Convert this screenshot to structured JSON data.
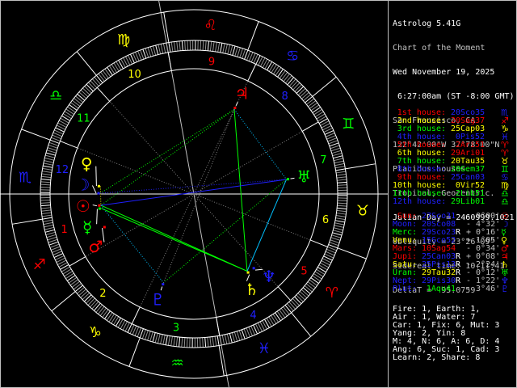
{
  "colors": {
    "fire": "#ff0000",
    "earth": "#ffff00",
    "air": "#00ff00",
    "water": "#2020ff",
    "white": "#ffffff",
    "gray": "#c0c0c0"
  },
  "info": [
    {
      "text": "Astrolog 5.41G",
      "tone": "w"
    },
    {
      "text": "Chart of the Moment",
      "tone": "g"
    },
    {
      "text": "Wed November 19, 2025",
      "tone": "w"
    },
    {
      "text": " 6:27:00am (ST -8:00 GMT)",
      "tone": "w"
    },
    {
      "text": "San Francisco, CA",
      "tone": "g"
    },
    {
      "text": "122°42'00\"W 37°78'00\"N",
      "tone": "g"
    },
    {
      "text": "Placidus houses.",
      "tone": "g"
    },
    {
      "text": "Tropical, Geocentric.",
      "tone": "g"
    },
    {
      "text": "Julian Day = 2460999.1021",
      "tone": "w"
    },
    {
      "text": "Obliquity = 23°26'09\"",
      "tone": "g"
    },
    {
      "text": "Sidereal time: 10:11:41",
      "tone": "g"
    },
    {
      "text": "DeltaT =  95.0759",
      "tone": "g"
    }
  ],
  "ascendant": 230.58,
  "signs": [
    {
      "name": "Ari",
      "glyph": "♈︎",
      "el": "fire",
      "icon": "aries-icon"
    },
    {
      "name": "Tau",
      "glyph": "♉︎",
      "el": "earth",
      "icon": "taurus-icon"
    },
    {
      "name": "Gem",
      "glyph": "♊︎",
      "el": "air",
      "icon": "gemini-icon"
    },
    {
      "name": "Can",
      "glyph": "♋︎",
      "el": "water",
      "icon": "cancer-icon"
    },
    {
      "name": "Leo",
      "glyph": "♌︎",
      "el": "fire",
      "icon": "leo-icon"
    },
    {
      "name": "Vir",
      "glyph": "♍︎",
      "el": "earth",
      "icon": "virgo-icon"
    },
    {
      "name": "Lib",
      "glyph": "♎︎",
      "el": "air",
      "icon": "libra-icon"
    },
    {
      "name": "Sco",
      "glyph": "♏︎",
      "el": "water",
      "icon": "scorpio-icon"
    },
    {
      "name": "Sag",
      "glyph": "♐︎",
      "el": "fire",
      "icon": "sagittarius-icon"
    },
    {
      "name": "Cap",
      "glyph": "♑︎",
      "el": "earth",
      "icon": "capricorn-icon"
    },
    {
      "name": "Aqu",
      "glyph": "♒︎",
      "el": "air",
      "icon": "aquarius-icon"
    },
    {
      "name": "Pis",
      "glyph": "♓︎",
      "el": "water",
      "icon": "pisces-icon"
    }
  ],
  "houses": [
    {
      "label": "1st house:",
      "num": "1",
      "value": "20Sco35",
      "lon": 230.58,
      "sign": 7
    },
    {
      "label": "2nd house:",
      "num": "2",
      "value": "20Sag37",
      "lon": 260.62,
      "sign": 8
    },
    {
      "label": "3rd house:",
      "num": "3",
      "value": "25Cap03",
      "lon": 295.05,
      "sign": 9
    },
    {
      "label": "4th house:",
      "num": "4",
      "value": "0Pis52",
      "lon": 330.87,
      "sign": 11
    },
    {
      "label": "5th house:",
      "num": "5",
      "value": "2Ari51",
      "lon": 2.85,
      "sign": 0
    },
    {
      "label": "6th house:",
      "num": "6",
      "value": "29Ari01",
      "lon": 29.02,
      "sign": 0
    },
    {
      "label": "7th house:",
      "num": "7",
      "value": "20Tau35",
      "lon": 50.58,
      "sign": 1
    },
    {
      "label": "8th house:",
      "num": "8",
      "value": "20Gem37",
      "lon": 80.62,
      "sign": 2
    },
    {
      "label": "9th house:",
      "num": "9",
      "value": "25Can03",
      "lon": 115.05,
      "sign": 3
    },
    {
      "label": "10th house:",
      "num": "10",
      "value": "0Vir52",
      "lon": 150.87,
      "sign": 5
    },
    {
      "label": "11th house:",
      "num": "11",
      "value": "2Lib51",
      "lon": 182.85,
      "sign": 6
    },
    {
      "label": "12th house:",
      "num": "12",
      "value": "29Lib01",
      "lon": 209.02,
      "sign": 6
    }
  ],
  "planets": [
    {
      "id": "sun",
      "label": "Sun:",
      "glyph": "☉",
      "el": "fire",
      "value": "27Sco31",
      "retro": "",
      "lat": "- 0°00'",
      "lon": 237.52,
      "sign": 7
    },
    {
      "id": "moon",
      "label": "Moon:",
      "glyph": "☽",
      "el": "water",
      "value": "20Sco08",
      "retro": "",
      "lat": "- 4°32'",
      "lon": 230.13,
      "sign": 7
    },
    {
      "id": "mercury",
      "label": "Merc:",
      "glyph": "☿",
      "el": "air",
      "value": "29Sco23",
      "retro": "R",
      "lat": "+ 0°16'",
      "lon": 239.38,
      "sign": 7
    },
    {
      "id": "venus",
      "label": "Venu:",
      "glyph": "♀",
      "el": "earth",
      "value": "15Sco52",
      "retro": "",
      "lat": "+ 1°05'",
      "lon": 225.87,
      "sign": 7
    },
    {
      "id": "mars",
      "label": "Mars:",
      "glyph": "♂",
      "el": "fire",
      "value": "10Sag54",
      "retro": "",
      "lat": "- 0°34'",
      "lon": 250.9,
      "sign": 8
    },
    {
      "id": "jupiter",
      "label": "Jupi:",
      "glyph": "♃",
      "el": "fire",
      "value": "25Can03",
      "retro": "R",
      "lat": "+ 0°08'",
      "lon": 115.05,
      "sign": 3
    },
    {
      "id": "saturn",
      "label": "Satu:",
      "glyph": "♄",
      "el": "earth",
      "value": "25Pis13",
      "retro": "R",
      "lat": "- 2°24'",
      "lon": 355.22,
      "sign": 11
    },
    {
      "id": "uranus",
      "label": "Uran:",
      "glyph": "♅",
      "el": "air",
      "value": "29Tau32",
      "retro": "R",
      "lat": "- 0°12'",
      "lon": 59.53,
      "sign": 1
    },
    {
      "id": "neptune",
      "label": "Nept:",
      "glyph": "♆",
      "el": "water",
      "value": "29Pis30",
      "retro": "R",
      "lat": "- 1°22'",
      "lon": 359.5,
      "sign": 11
    },
    {
      "id": "pluto",
      "label": "Plut:",
      "glyph": "♇",
      "el": "water",
      "value": "1Aqu41",
      "retro": "",
      "lat": "- 3°46'",
      "lon": 301.68,
      "sign": 10
    }
  ],
  "aspect_colors": {
    "conjunction": "#ffff00",
    "opposition": "#2020ff",
    "trine": "#00ff00",
    "sextile": "#00c0ff",
    "minor": "#808080"
  },
  "aspects": [
    {
      "a": "jupiter",
      "b": "saturn",
      "type": "trine",
      "exact": true
    },
    {
      "a": "sun",
      "b": "saturn",
      "type": "trine",
      "exact": true
    },
    {
      "a": "mercury",
      "b": "saturn",
      "type": "trine",
      "exact": true
    },
    {
      "a": "jupiter",
      "b": "sun",
      "type": "trine",
      "exact": false
    },
    {
      "a": "jupiter",
      "b": "moon",
      "type": "trine",
      "exact": false
    },
    {
      "a": "sun",
      "b": "uranus",
      "type": "opposition",
      "exact": true
    },
    {
      "a": "moon",
      "b": "uranus",
      "type": "opposition",
      "exact": false
    },
    {
      "a": "saturn",
      "b": "uranus",
      "type": "sextile",
      "exact": true
    },
    {
      "a": "sun",
      "b": "pluto",
      "type": "sextile",
      "exact": false
    },
    {
      "a": "uranus",
      "b": "pluto",
      "type": "trine",
      "exact": false
    },
    {
      "a": "jupiter",
      "b": "uranus",
      "type": "sextile",
      "exact": false
    },
    {
      "a": "jupiter",
      "b": "pluto",
      "type": "minor",
      "exact": false
    },
    {
      "a": "venus",
      "b": "sun",
      "type": "conjunction",
      "exact": false
    }
  ],
  "summary": [
    "Fire: 1, Earth: 1,",
    "Air : 1, Water: 7",
    "Car: 1, Fix: 6, Mut: 3",
    "Yang: 2, Yin: 8",
    "M: 4, N: 6, A: 6, D: 4",
    "Ang: 6, Suc: 1, Cad: 3",
    "Learn: 2, Share: 8"
  ]
}
